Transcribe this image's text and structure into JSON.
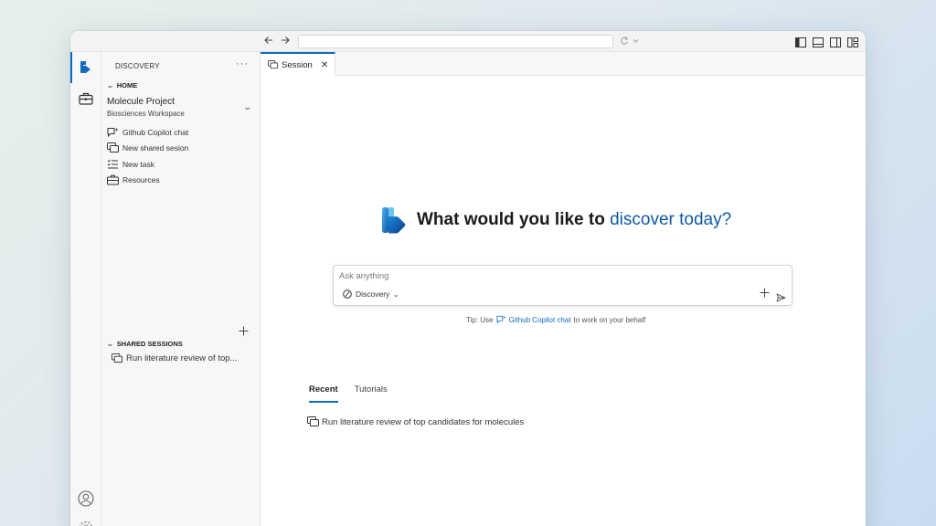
{
  "window": {
    "address_value": ""
  },
  "sidebar": {
    "title": "DISCOVERY",
    "more_label": "···",
    "home_header": "HOME",
    "project": {
      "name": "Molecule Project",
      "workspace": "Biosciences Workspace"
    },
    "items": [
      {
        "label": "Github Copilot chat",
        "icon": "copilot-chat-icon"
      },
      {
        "label": "New shared sesion",
        "icon": "shared-session-icon"
      },
      {
        "label": "New task",
        "icon": "task-list-icon"
      },
      {
        "label": "Resources",
        "icon": "briefcase-icon"
      }
    ],
    "shared_header": "SHARED SESSIONS",
    "shared_sessions": [
      {
        "label": "Run literature review of top..."
      }
    ]
  },
  "editor": {
    "tab_label": "Session",
    "hero": {
      "part1": "What would you like to ",
      "part2": "discover today?"
    },
    "ask": {
      "placeholder": "Ask anything",
      "value": "",
      "mode_label": "Discovery"
    },
    "tip": {
      "prefix": "Tip: Use",
      "link": "Github Copilot chat",
      "suffix": "to work on your behalf"
    },
    "tabs": [
      {
        "label": "Recent",
        "active": true
      },
      {
        "label": "Tutorials",
        "active": false
      }
    ],
    "recent_items": [
      {
        "label": "Run literature review of top candidates for molecules"
      }
    ]
  },
  "colors": {
    "accent": "#0f6cbd",
    "hero_blue": "#0f5aa0"
  }
}
